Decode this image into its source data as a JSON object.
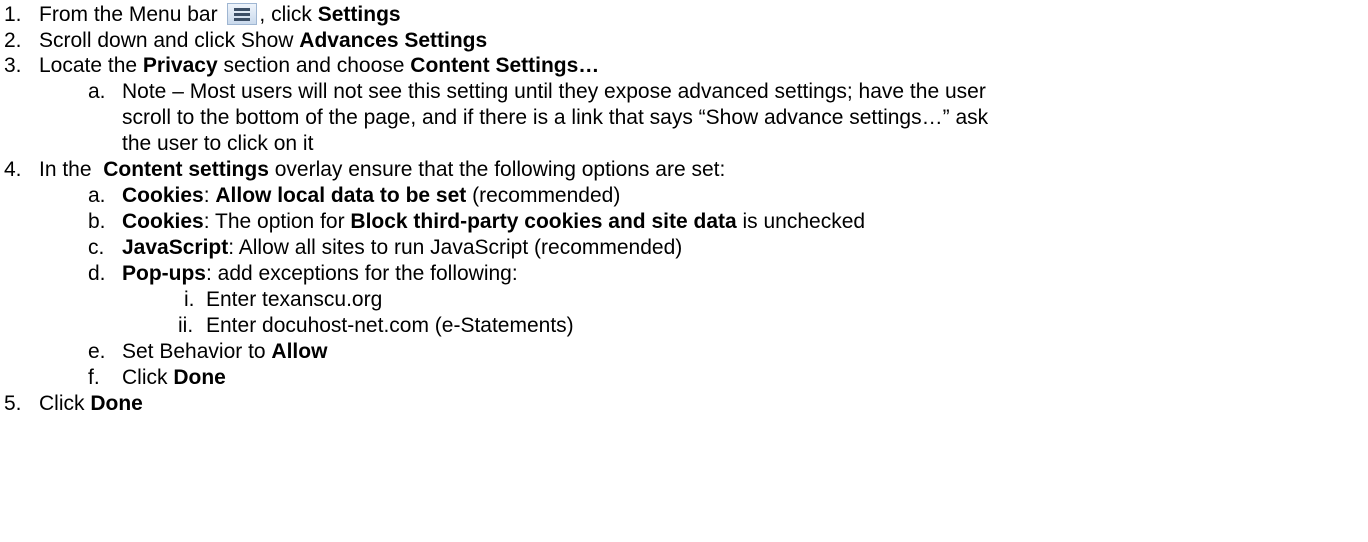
{
  "steps": [
    {
      "num": "1.",
      "p1": "From the Menu bar ",
      "icon": "menu-icon",
      "p2": ", click ",
      "b1": "Settings"
    },
    {
      "num": "2.",
      "p1": "Scroll down and click Show ",
      "b1": "Advances Settings"
    },
    {
      "num": "3.",
      "p1": "Locate the ",
      "b1": "Privacy",
      "p2": " section and choose ",
      "b2": "Content Settings…"
    },
    {
      "num": "4.",
      "p1": "In the  ",
      "b1": "Content settings",
      "p2": " overlay ensure that the following options are set:"
    },
    {
      "num": "5.",
      "p1": "Click ",
      "b1": "Done"
    }
  ],
  "note": {
    "marker": "a.",
    "line1": "Note – Most users will not see this setting until they expose advanced settings; have the user",
    "line2": "scroll to the bottom of the page, and if there is a link that says “Show advance settings…” ask",
    "line3": "the user to click on it"
  },
  "sub": [
    {
      "marker": "a.",
      "b1": "Cookies",
      "p1": ": ",
      "b2": "Allow local data to be set",
      "p2": " (recommended)"
    },
    {
      "marker": "b.",
      "b1": "Cookies",
      "p1": ": The option for ",
      "b2": "Block third-party cookies and site data",
      "p2": " is unchecked"
    },
    {
      "marker": "c.",
      "b1": "JavaScript",
      "p1": ": Allow all sites to run JavaScript (recommended)"
    },
    {
      "marker": "d.",
      "b1": "Pop-ups",
      "p1": ": add exceptions for the following:"
    },
    {
      "marker": "e.",
      "p1": "Set Behavior to ",
      "b1": "Allow"
    },
    {
      "marker": "f.",
      "p1": "Click ",
      "b1": "Done"
    }
  ],
  "subsub": [
    {
      "marker": "i.",
      "p1": "Enter texanscu.org"
    },
    {
      "marker": "ii.",
      "p1": "Enter docuhost-net.com (e-Statements)"
    }
  ]
}
